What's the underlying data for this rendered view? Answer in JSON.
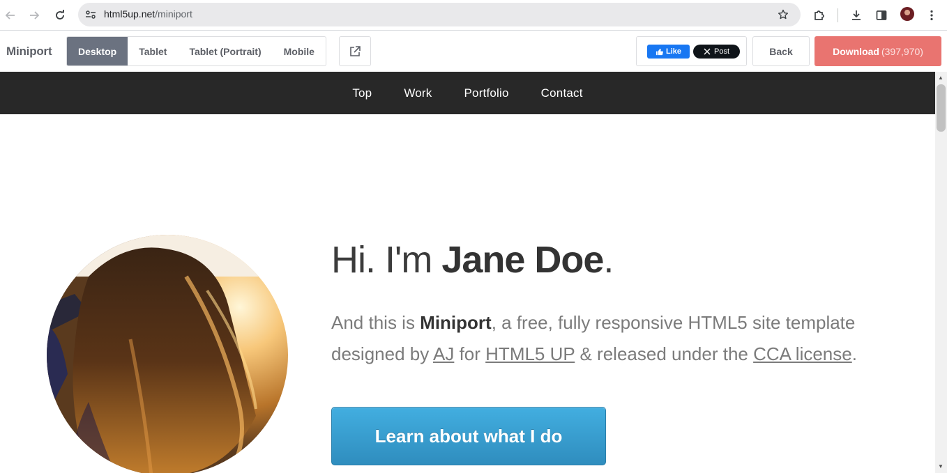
{
  "browser": {
    "url_host": "html5up.net",
    "url_path": "/miniport",
    "icons": [
      "back-icon",
      "forward-icon",
      "reload-icon",
      "site-settings-icon",
      "bookmark-star-icon",
      "extensions-icon",
      "downloads-icon",
      "side-panel-icon",
      "profile-avatar",
      "more-menu-icon"
    ]
  },
  "toolbar": {
    "brand": "Miniport",
    "views": [
      {
        "label": "Desktop",
        "active": true
      },
      {
        "label": "Tablet",
        "active": false
      },
      {
        "label": "Tablet (Portrait)",
        "active": false
      },
      {
        "label": "Mobile",
        "active": false
      }
    ],
    "fb_like": "Like",
    "x_post": "Post",
    "back": "Back",
    "download": "Download",
    "download_count": "(397,970)",
    "colors": {
      "active_view": "#6b7280",
      "download": "#e97470"
    }
  },
  "site_nav": {
    "items": [
      "Top",
      "Work",
      "Portfolio",
      "Contact"
    ]
  },
  "hero": {
    "title_prefix": "Hi. I'm ",
    "title_name": "Jane Doe",
    "title_suffix": ".",
    "text_1": "And this is ",
    "text_brand": "Miniport",
    "text_2": ", a free, fully responsive HTML5 site template designed by ",
    "text_link_aj": "AJ",
    "text_3": " for ",
    "text_link_html5up": "HTML5 UP",
    "text_4": " & released under the ",
    "text_link_cca": "CCA license",
    "text_5": ".",
    "cta": "Learn about what I do",
    "cta_color": "#3a9fd2"
  }
}
